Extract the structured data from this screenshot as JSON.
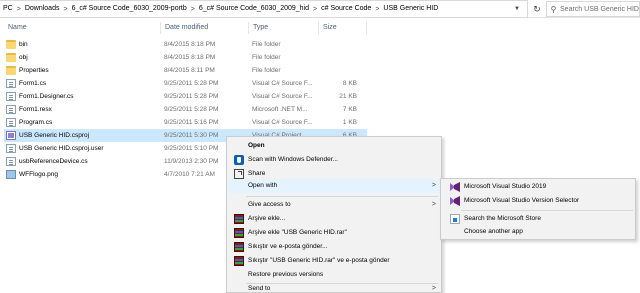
{
  "address": {
    "crumbs": [
      "PC",
      "Downloads",
      "6_c# Source Code_6030_2009-portb",
      "6_c# Source Code_6030_2009_hid",
      "c# Source Code",
      "USB Generic HID"
    ],
    "separator": ">",
    "search_placeholder": "Search USB Generic HID"
  },
  "columns": {
    "name": "Name",
    "date": "Date modified",
    "type": "Type",
    "size": "Size"
  },
  "files": [
    {
      "name": "bin",
      "date": "8/4/2015 8:18 PM",
      "type": "File folder",
      "size": "",
      "icon": "folder"
    },
    {
      "name": "obj",
      "date": "8/4/2015 8:18 PM",
      "type": "File folder",
      "size": "",
      "icon": "folder"
    },
    {
      "name": "Properties",
      "date": "8/4/2015 8:11 PM",
      "type": "File folder",
      "size": "",
      "icon": "folder"
    },
    {
      "name": "Form1.cs",
      "date": "9/25/2011 5:28 PM",
      "type": "Visual C# Source F...",
      "size": "8 KB",
      "icon": "doc"
    },
    {
      "name": "Form1.Designer.cs",
      "date": "9/25/2011 5:28 PM",
      "type": "Visual C# Source F...",
      "size": "21 KB",
      "icon": "doc"
    },
    {
      "name": "Form1.resx",
      "date": "9/25/2011 5:28 PM",
      "type": "Microsoft .NET M...",
      "size": "7 KB",
      "icon": "doc"
    },
    {
      "name": "Program.cs",
      "date": "9/25/2011 5:16 PM",
      "type": "Visual C# Source F...",
      "size": "1 KB",
      "icon": "doc"
    },
    {
      "name": "USB Generic HID.csproj",
      "date": "9/25/2011 5:30 PM",
      "type": "Visual C# Project ...",
      "size": "6 KB",
      "icon": "proj",
      "selected": true
    },
    {
      "name": "USB Generic HID.csproj.user",
      "date": "9/25/2011 5:10 PM",
      "type": "",
      "size": "",
      "icon": "doc"
    },
    {
      "name": "usbReferenceDevice.cs",
      "date": "11/9/2013 2:30 PM",
      "type": "",
      "size": "",
      "icon": "doc"
    },
    {
      "name": "WFFlogo.png",
      "date": "4/7/2010 7:21 AM",
      "type": "",
      "size": "",
      "icon": "img"
    }
  ],
  "context_menu": {
    "open": "Open",
    "scan": "Scan with Windows Defender...",
    "share": "Share",
    "open_with": "Open with",
    "give_access": "Give access to",
    "add_archive": "Arşive ekle...",
    "add_rar": "Arşive ekle \"USB Generic HID.rar\"",
    "compress_email": "Sıkıştır ve e-posta gönder...",
    "compress_rar_email": "Sıkıştır \"USB Generic HID.rar\" ve e-posta gönder",
    "restore": "Restore previous versions",
    "send_to": "Send to",
    "arrow": ">"
  },
  "open_with_menu": {
    "vs2019": "Microsoft Visual Studio 2019",
    "vs_selector": "Microsoft Visual Studio Version Selector",
    "store": "Search the Microsoft Store",
    "choose": "Choose another app"
  }
}
